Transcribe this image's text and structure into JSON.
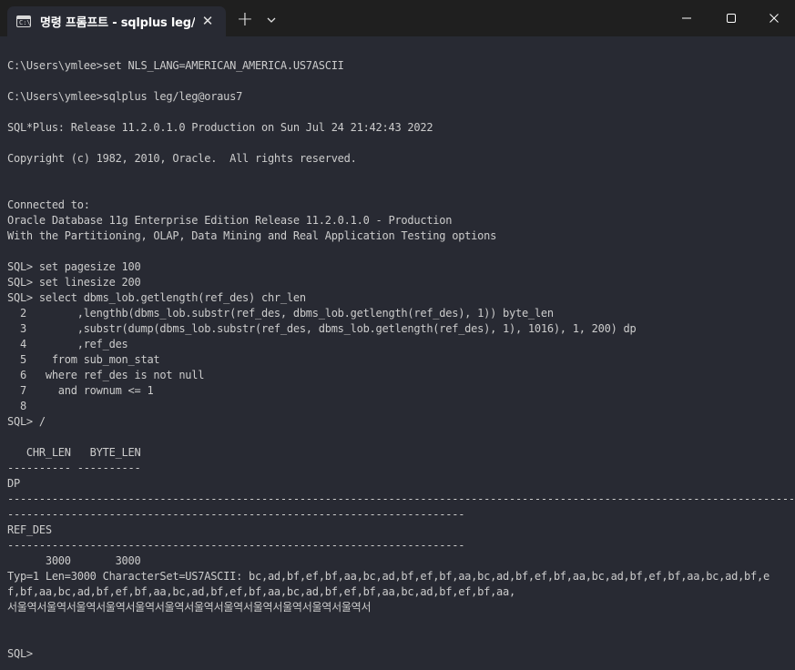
{
  "window": {
    "tab_icon_text": "C:\\",
    "tab_title": "명령 프롬프트 - sqlplus  leg/l",
    "tab_close": "✕",
    "new_tab": "+"
  },
  "icons": {
    "tab_icon": "terminal-icon",
    "close": "close-icon",
    "new_tab": "plus-icon",
    "dropdown": "chevron-down-icon",
    "minimize": "minimize-icon",
    "maximize": "maximize-icon",
    "window_close": "window-close-icon"
  },
  "colors": {
    "titlebar": "#1f1f1f",
    "tab_bg": "#282a33",
    "terminal_bg": "#282a33",
    "text": "#cccccc"
  },
  "terminal": {
    "lines": [
      "C:\\Users\\ymlee>set NLS_LANG=AMERICAN_AMERICA.US7ASCII",
      "",
      "C:\\Users\\ymlee>sqlplus leg/leg@oraus7",
      "",
      "SQL*Plus: Release 11.2.0.1.0 Production on Sun Jul 24 21:42:43 2022",
      "",
      "Copyright (c) 1982, 2010, Oracle.  All rights reserved.",
      "",
      "",
      "Connected to:",
      "Oracle Database 11g Enterprise Edition Release 11.2.0.1.0 - Production",
      "With the Partitioning, OLAP, Data Mining and Real Application Testing options",
      "",
      "SQL> set pagesize 100",
      "SQL> set linesize 200",
      "SQL> select dbms_lob.getlength(ref_des) chr_len",
      "  2        ,lengthb(dbms_lob.substr(ref_des, dbms_lob.getlength(ref_des), 1)) byte_len",
      "  3        ,substr(dump(dbms_lob.substr(ref_des, dbms_lob.getlength(ref_des), 1), 1016), 1, 200) dp",
      "  4        ,ref_des",
      "  5    from sub_mon_stat",
      "  6   where ref_des is not null",
      "  7     and rownum <= 1",
      "  8",
      "SQL> /",
      "",
      "   CHR_LEN   BYTE_LEN",
      "---------- ----------",
      "DP",
      "--------------------------------------------------------------------------------------------------------------------------------",
      "------------------------------------------------------------------------",
      "REF_DES",
      "------------------------------------------------------------------------",
      "      3000       3000",
      "Typ=1 Len=3000 CharacterSet=US7ASCII: bc,ad,bf,ef,bf,aa,bc,ad,bf,ef,bf,aa,bc,ad,bf,ef,bf,aa,bc,ad,bf,ef,bf,aa,bc,ad,bf,e",
      "f,bf,aa,bc,ad,bf,ef,bf,aa,bc,ad,bf,ef,bf,aa,bc,ad,bf,ef,bf,aa,bc,ad,bf,ef,bf,aa,",
      "서울역서울역서울역서울역서울역서울역서울역서울역서울역서울역서울역서울역서",
      "",
      "",
      "SQL>"
    ]
  }
}
